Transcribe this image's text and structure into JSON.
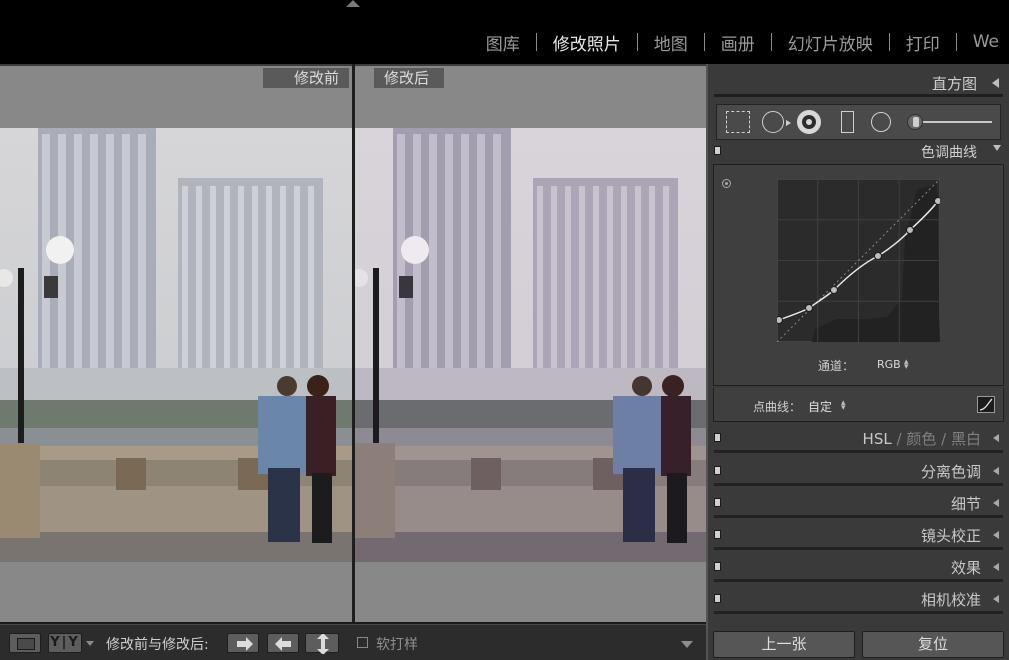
{
  "modules": [
    "图库",
    "修改照片",
    "地图",
    "画册",
    "幻灯片放映",
    "打印",
    "We"
  ],
  "active_module": "修改照片",
  "compare": {
    "before_label": "修改前",
    "after_label": "修改后"
  },
  "toolbar": {
    "view_yy_label": "Y|Y",
    "compare_label": "修改前与修改后:",
    "softproof_label": "软打样"
  },
  "panels": {
    "histogram_title": "直方图",
    "tonecurve_title": "色调曲线",
    "channel_label": "通道：",
    "channel_value": "RGB",
    "pointcurve_label": "点曲线：",
    "pointcurve_value": "自定",
    "hsl_title": "HSL",
    "hsl_color": "颜色",
    "hsl_bw": "黑白",
    "hsl_sep": "/",
    "split_toning": "分离色调",
    "detail": "细节",
    "lens_corrections": "镜头校正",
    "effects": "效果",
    "camera_calibration": "相机校准"
  },
  "buttons": {
    "previous": "上一张",
    "reset": "复位"
  },
  "icons": {
    "crop": "crop-overlay-icon",
    "spot": "spot-removal-icon",
    "redeye": "red-eye-icon",
    "graduated": "graduated-filter-icon",
    "radial": "radial-filter-icon",
    "brush": "adjustment-brush-icon"
  },
  "colors": {
    "accent_active_module": "#e8e8e8",
    "panel_bg": "#3a3a3a",
    "compare_bg": "#888888"
  }
}
